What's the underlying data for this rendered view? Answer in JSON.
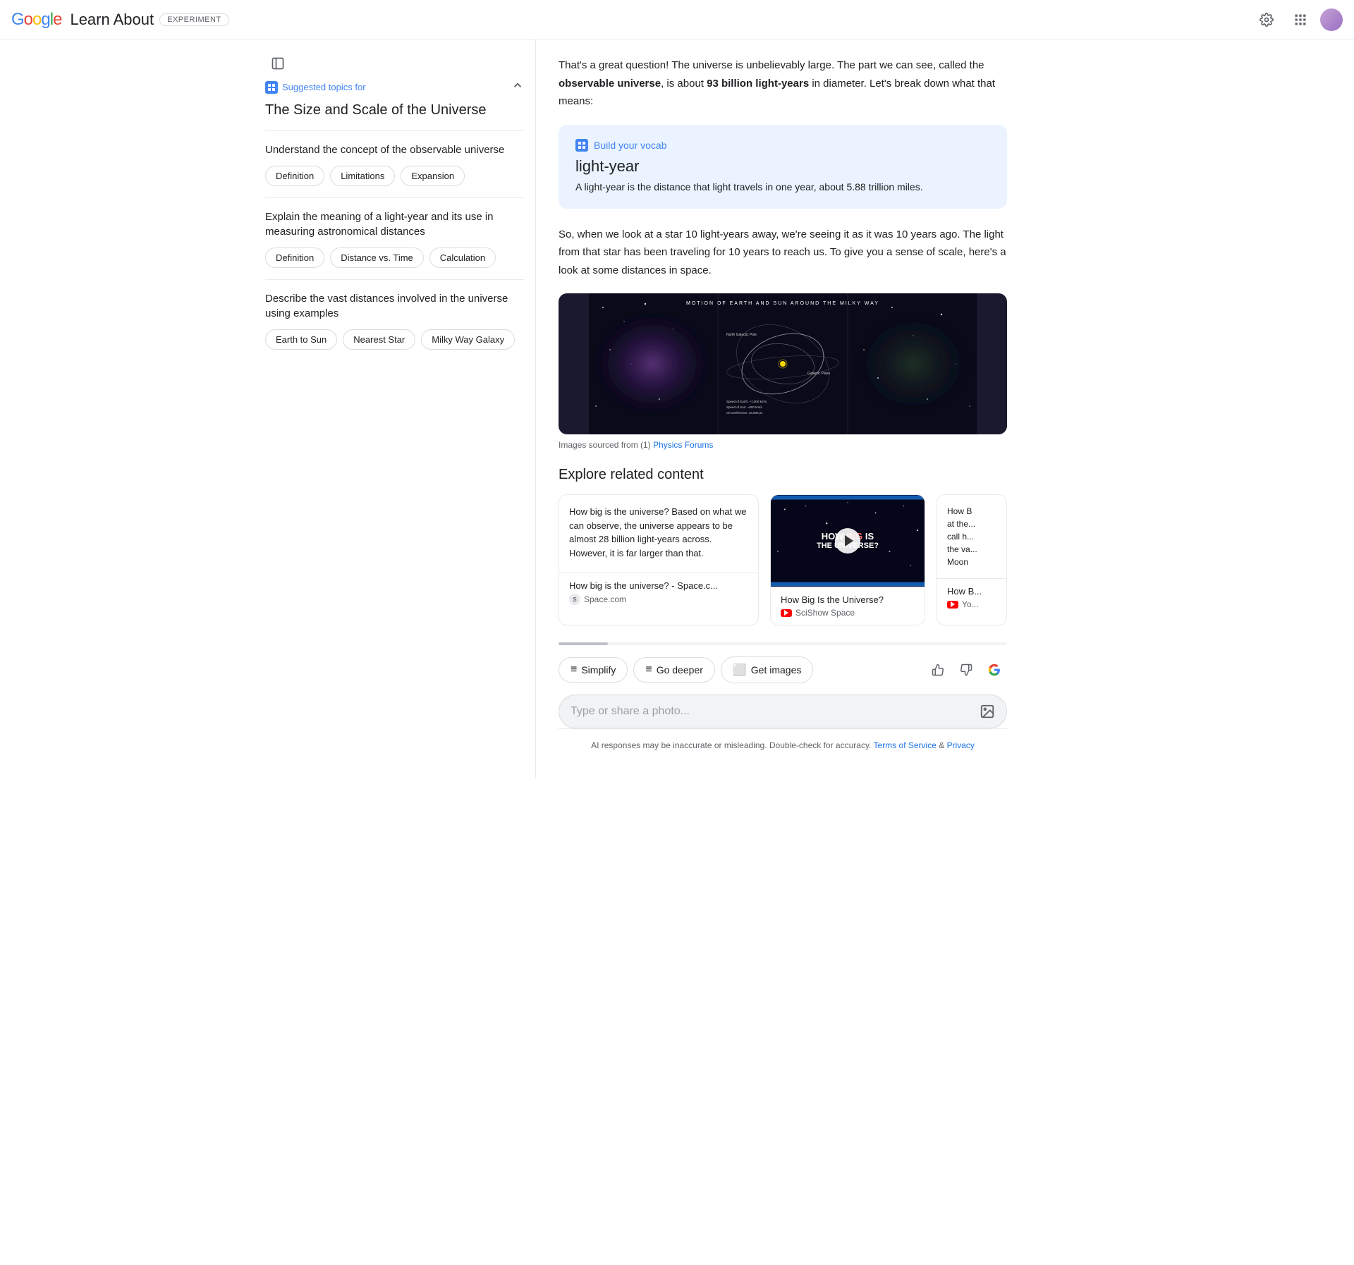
{
  "header": {
    "title": "Learn About",
    "badge": "EXPERIMENT",
    "logo_letters": [
      {
        "char": "G",
        "color": "#4285F4"
      },
      {
        "char": "o",
        "color": "#EA4335"
      },
      {
        "char": "o",
        "color": "#FBBC04"
      },
      {
        "char": "g",
        "color": "#4285F4"
      },
      {
        "char": "l",
        "color": "#34A853"
      },
      {
        "char": "e",
        "color": "#EA4335"
      }
    ]
  },
  "sidebar": {
    "suggested_label": "Suggested topics for",
    "main_title": "The Size and Scale of the Universe",
    "sections": [
      {
        "id": "observable-universe",
        "title": "Understand the concept of the observable universe",
        "chips": [
          "Definition",
          "Limitations",
          "Expansion"
        ]
      },
      {
        "id": "light-year",
        "title": "Explain the meaning of a light-year and its use in measuring astronomical distances",
        "chips": [
          "Definition",
          "Distance vs. Time",
          "Calculation"
        ]
      },
      {
        "id": "vast-distances",
        "title": "Describe the vast distances involved in the universe using examples",
        "chips": [
          "Earth to Sun",
          "Nearest Star",
          "Milky Way Galaxy"
        ]
      }
    ]
  },
  "main": {
    "intro_paragraph": "That's a great question! The universe is unbelievably large. The part we can see, called the observable universe, is about 93 billion light-years in diameter. Let's break down what that means:",
    "vocab_card": {
      "label": "Build your vocab",
      "term": "light-year",
      "definition": "A light-year is the distance that light travels in one year, about 5.88 trillion miles."
    },
    "followup_paragraph": "So, when we look at a star 10 light-years away, we're seeing it as it was 10 years ago. The light from that star has been traveling for 10 years to reach us. To give you a sense of scale, here's a look at some distances in space.",
    "image_caption": "Images sourced from (1) Physics Forums",
    "image_link_text": "Physics Forums",
    "image_title": "MOTION OF EARTH AND SUN AROUND THE MILKY WAY",
    "explore_title": "Explore related content",
    "explore_cards": [
      {
        "id": "space-article",
        "text": "How big is the universe? Based on what we can observe, the universe appears to be almost 28 billion light-years across. However, it is far larger than that.",
        "title": "How big is the universe? - Space.c...",
        "source": "Space.com",
        "source_type": "website",
        "has_image": false
      },
      {
        "id": "scishow-video",
        "text": "How Big Is the Universe?",
        "title": "How Big Is the Universe?",
        "source": "SciShow Space",
        "source_type": "youtube",
        "has_image": true,
        "image_text": "HOW BIG IS THE UNIVERSE?"
      },
      {
        "id": "partial-card",
        "text": "How B... at the... call h... the va... Moon",
        "title": "How B...",
        "source": "Yo...",
        "source_type": "youtube",
        "has_image": false
      }
    ],
    "toolbar": {
      "simplify_label": "Simplify",
      "go_deeper_label": "Go deeper",
      "get_images_label": "Get images"
    },
    "input_placeholder": "Type or share a photo...",
    "footer_text": "AI responses may be inaccurate or misleading. Double-check for accuracy.",
    "terms_label": "Terms of Service",
    "privacy_label": "Privacy"
  }
}
